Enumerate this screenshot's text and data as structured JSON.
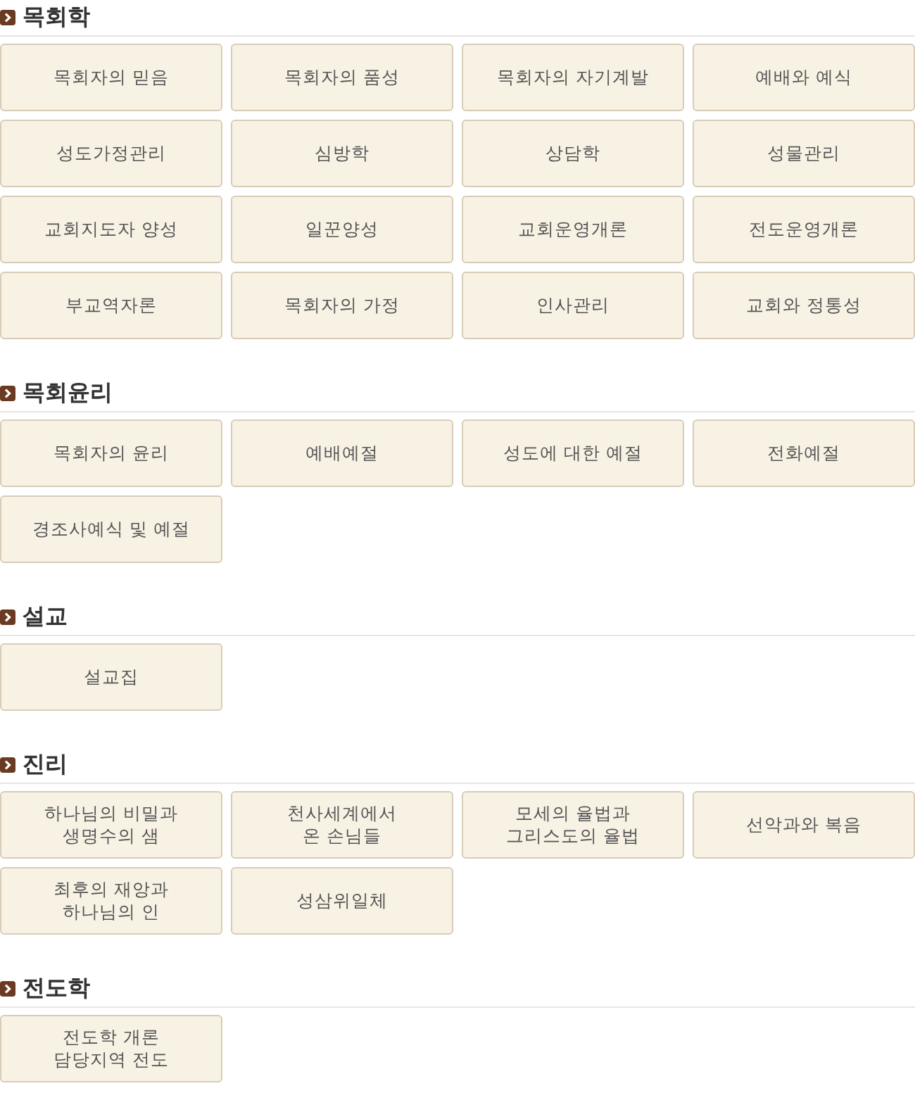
{
  "sections": [
    {
      "title": "목회학",
      "items": [
        "목회자의 믿음",
        "목회자의 품성",
        "목회자의 자기계발",
        "예배와 예식",
        "성도가정관리",
        "심방학",
        "상담학",
        "성물관리",
        "교회지도자 양성",
        "일꾼양성",
        "교회운영개론",
        "전도운영개론",
        "부교역자론",
        "목회자의 가정",
        "인사관리",
        "교회와 정통성"
      ]
    },
    {
      "title": "목회윤리",
      "items": [
        "목회자의 윤리",
        "예배예절",
        "성도에 대한 예절",
        "전화예절",
        "경조사예식 및 예절"
      ]
    },
    {
      "title": "설교",
      "items": [
        "설교집"
      ]
    },
    {
      "title": "진리",
      "items": [
        "하나님의 비밀과\n생명수의 샘",
        "천사세계에서\n온 손님들",
        "모세의 율법과\n그리스도의 율법",
        "선악과와 복음",
        "최후의 재앙과\n하나님의 인",
        "성삼위일체"
      ]
    },
    {
      "title": "전도학",
      "items": [
        "전도학 개론\n담당지역 전도"
      ]
    }
  ]
}
